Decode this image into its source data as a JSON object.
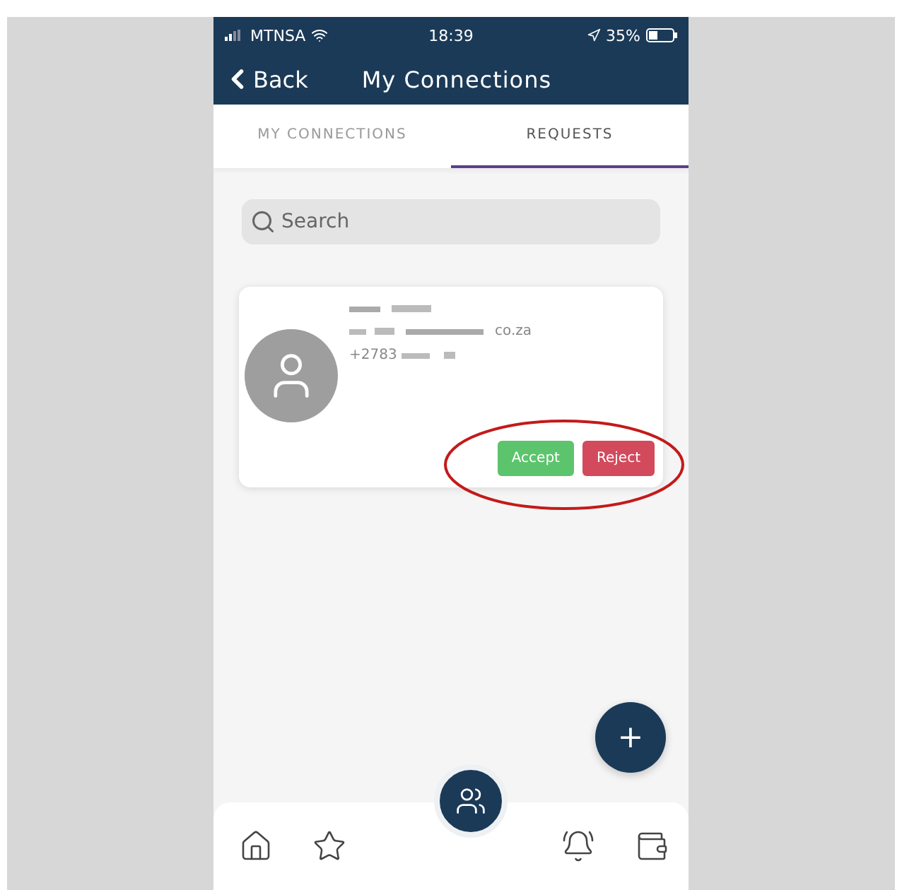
{
  "status_bar": {
    "carrier": "MTNSA",
    "time": "18:39",
    "battery": "35%"
  },
  "header": {
    "back": "Back",
    "title": "My Connections"
  },
  "tabs": [
    {
      "label": "MY CONNECTIONS",
      "selected": false
    },
    {
      "label": "REQUESTS",
      "selected": true
    }
  ],
  "search": {
    "placeholder": "Search"
  },
  "requests": [
    {
      "email_end": "co.za",
      "phone_start": "+2783",
      "actions": [
        {
          "label": "Accept",
          "kind": "accept"
        },
        {
          "label": "Reject",
          "kind": "reject"
        }
      ]
    }
  ],
  "fab": {
    "label": "+"
  }
}
